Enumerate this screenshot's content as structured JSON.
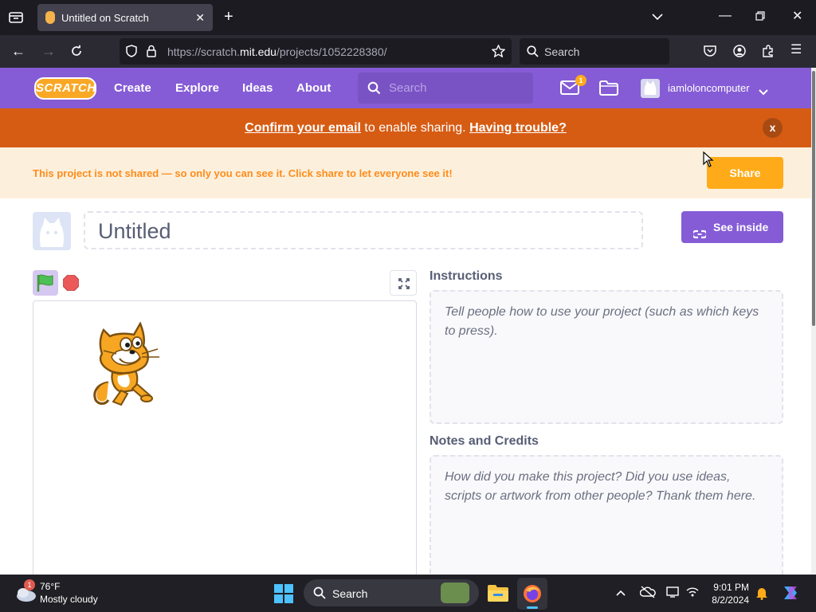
{
  "browser": {
    "tab_title": "Untitled on Scratch",
    "url_prefix": "https://scratch.",
    "url_host": "mit.edu",
    "url_path": "/projects/1052228380/",
    "search_placeholder": "Search"
  },
  "header": {
    "logo": "SCRATCH",
    "nav": [
      "Create",
      "Explore",
      "Ideas",
      "About"
    ],
    "search_placeholder": "Search",
    "message_count": "1",
    "username": "iamloloncomputer"
  },
  "email_banner": {
    "link1": "Confirm your email",
    "text": " to enable sharing. ",
    "link2": "Having trouble?",
    "close": "x"
  },
  "share_banner": {
    "message": "This project is not shared — so only you can see it. Click share to let everyone see it!",
    "button": "Share"
  },
  "project": {
    "title": "Untitled",
    "see_inside": "See inside",
    "instructions_label": "Instructions",
    "instructions_placeholder": "Tell people how to use your project (such as which keys to press).",
    "notes_label": "Notes and Credits",
    "notes_placeholder": "How did you make this project? Did you use ideas, scripts or artwork from other people? Thank them here."
  },
  "taskbar": {
    "weather_badge": "1",
    "temperature": "76°F",
    "condition": "Mostly cloudy",
    "search": "Search",
    "time": "9:01 PM",
    "date": "8/2/2024"
  },
  "colors": {
    "scratch_purple": "#855cd6",
    "email_banner": "#d65c14",
    "share_orange": "#ffab19"
  }
}
